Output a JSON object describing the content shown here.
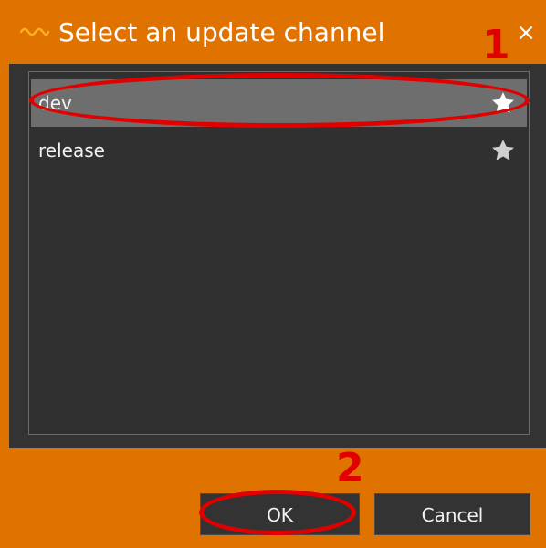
{
  "dialog": {
    "title": "Select an update channel",
    "close_glyph": "×",
    "title_icon": "orange-wave-icon"
  },
  "channels": [
    {
      "label": "dev",
      "selected": true,
      "starred": true,
      "star_icon": "star-icon"
    },
    {
      "label": "release",
      "selected": false,
      "starred": false,
      "star_icon": "star-icon"
    }
  ],
  "buttons": {
    "ok_label": "OK",
    "cancel_label": "Cancel"
  },
  "annotations": {
    "step_1": "1",
    "step_2": "2"
  },
  "colors": {
    "accent": "#e07200",
    "panel": "#333333",
    "selected_row": "#6e6e6e",
    "annotation": "#e00000"
  }
}
